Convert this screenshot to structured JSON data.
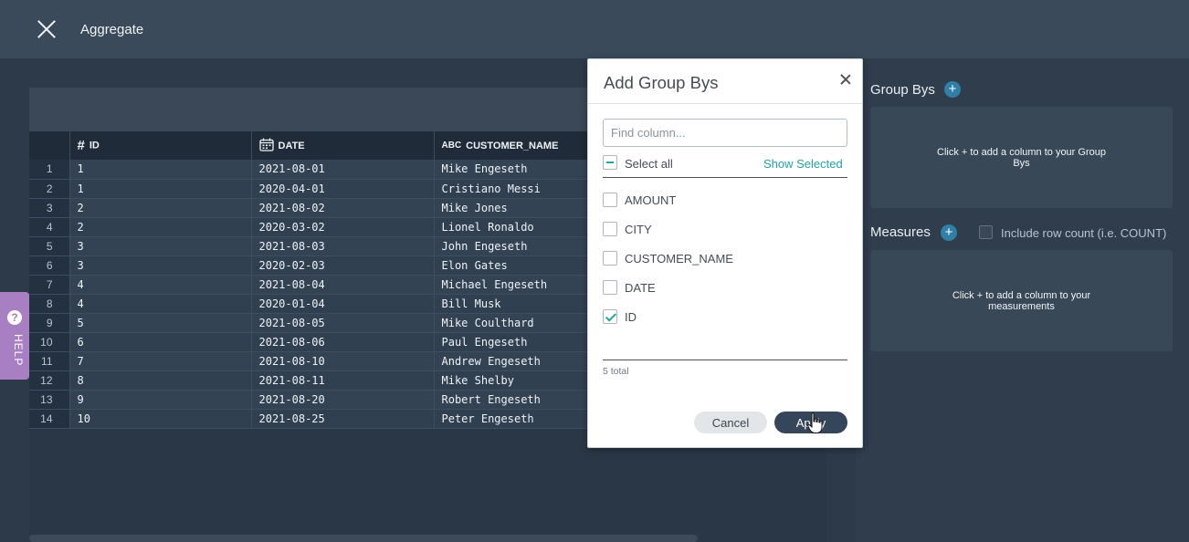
{
  "header": {
    "title": "Aggregate",
    "close_icon": "close-icon"
  },
  "grid": {
    "columns": [
      {
        "label": "ID",
        "icon": "#"
      },
      {
        "label": "DATE",
        "icon": "calendar-icon"
      },
      {
        "label": "CUSTOMER_NAME",
        "icon": "ABC"
      }
    ],
    "rows": [
      {
        "n": "1",
        "id": "1",
        "date": "2021-08-01",
        "name": "Mike Engeseth"
      },
      {
        "n": "2",
        "id": "1",
        "date": "2020-04-01",
        "name": "Cristiano Messi"
      },
      {
        "n": "3",
        "id": "2",
        "date": "2021-08-02",
        "name": "Mike Jones"
      },
      {
        "n": "4",
        "id": "2",
        "date": "2020-03-02",
        "name": "Lionel Ronaldo"
      },
      {
        "n": "5",
        "id": "3",
        "date": "2021-08-03",
        "name": "John Engeseth"
      },
      {
        "n": "6",
        "id": "3",
        "date": "2020-02-03",
        "name": "Elon Gates"
      },
      {
        "n": "7",
        "id": "4",
        "date": "2021-08-04",
        "name": "Michael Engeseth"
      },
      {
        "n": "8",
        "id": "4",
        "date": "2020-01-04",
        "name": "Bill Musk"
      },
      {
        "n": "9",
        "id": "5",
        "date": "2021-08-05",
        "name": "Mike Coulthard"
      },
      {
        "n": "10",
        "id": "6",
        "date": "2021-08-06",
        "name": "Paul Engeseth"
      },
      {
        "n": "11",
        "id": "7",
        "date": "2021-08-10",
        "name": "Andrew Engeseth"
      },
      {
        "n": "12",
        "id": "8",
        "date": "2021-08-11",
        "name": "Mike Shelby"
      },
      {
        "n": "13",
        "id": "9",
        "date": "2021-08-20",
        "name": "Robert Engeseth"
      },
      {
        "n": "14",
        "id": "10",
        "date": "2021-08-25",
        "name": "Peter Engeseth"
      }
    ]
  },
  "help": {
    "label": "HELP",
    "icon": "?"
  },
  "right_panel": {
    "group_bys_label": "Group Bys",
    "group_bys_hint": "Click + to add a column to your Group Bys",
    "measures_label": "Measures",
    "include_count_label": "Include row count (i.e. COUNT)",
    "include_count_checked": false,
    "measures_hint": "Click + to add a column to your measurements",
    "plus_symbol": "+"
  },
  "modal": {
    "title": "Add Group Bys",
    "search_placeholder": "Find column...",
    "search_value": "",
    "select_all_label": "Select all",
    "show_selected_label": "Show Selected",
    "options": [
      {
        "label": "AMOUNT",
        "checked": false
      },
      {
        "label": "CITY",
        "checked": false
      },
      {
        "label": "CUSTOMER_NAME",
        "checked": false
      },
      {
        "label": "DATE",
        "checked": false
      },
      {
        "label": "ID",
        "checked": true
      }
    ],
    "total_label": "5 total",
    "cancel_label": "Cancel",
    "apply_label": "Apply"
  },
  "colors": {
    "accent_teal": "#22a5a0",
    "help_purple": "#a97fc4",
    "apply_button": "#36465a"
  }
}
